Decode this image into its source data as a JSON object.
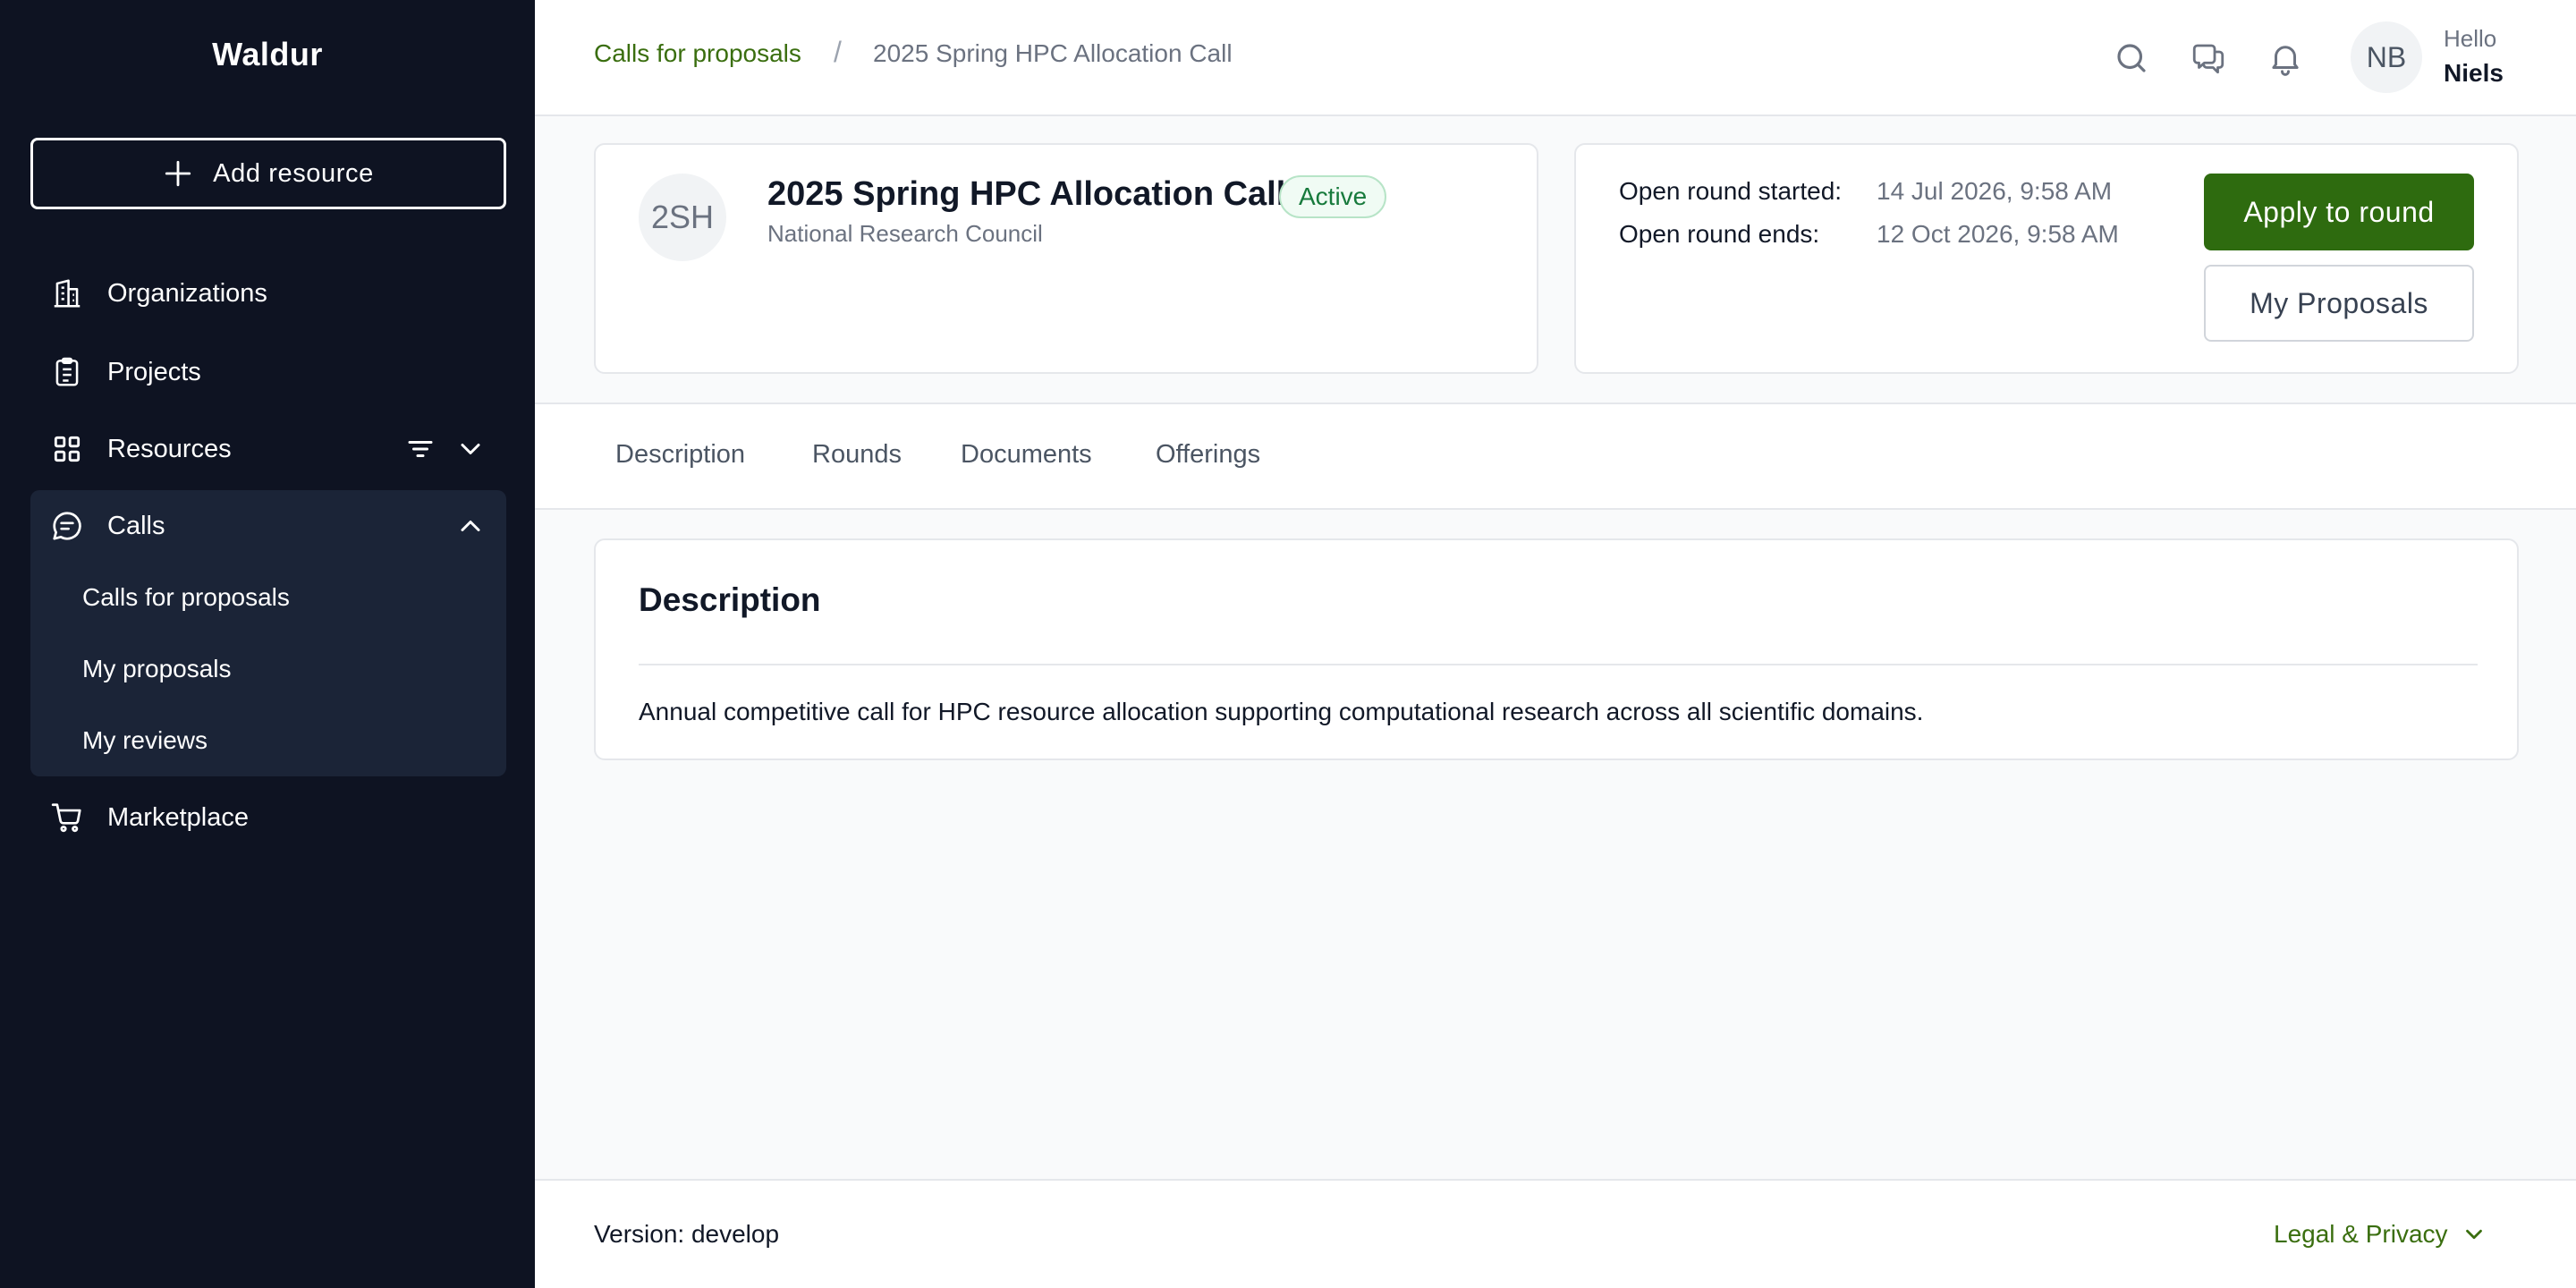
{
  "app": {
    "brand": "Waldur"
  },
  "sidebar": {
    "add_resource_label": "Add resource",
    "items": [
      {
        "label": "Organizations",
        "icon": "building-icon"
      },
      {
        "label": "Projects",
        "icon": "clipboard-icon"
      },
      {
        "label": "Resources",
        "icon": "grid-icon"
      },
      {
        "label": "Calls",
        "icon": "chat-bubble-icon"
      },
      {
        "label": "Marketplace",
        "icon": "cart-icon"
      }
    ],
    "calls_subitems": [
      {
        "label": "Calls for proposals"
      },
      {
        "label": "My proposals"
      },
      {
        "label": "My reviews"
      }
    ]
  },
  "header": {
    "breadcrumb_link": "Calls for proposals",
    "breadcrumb_separator": "/",
    "breadcrumb_current": "2025 Spring HPC Allocation Call",
    "icons": [
      "search-icon",
      "chat-icon",
      "bell-icon"
    ],
    "avatar_initials": "NB",
    "greeting": "Hello",
    "user_name": "Niels"
  },
  "call": {
    "initials": "2SH",
    "title": "2025 Spring HPC Allocation Call",
    "status": "Active",
    "organization": "National Research Council",
    "round_started_label": "Open round started:",
    "round_started_value": "14 Jul 2026, 9:58 AM",
    "round_ends_label": "Open round ends:",
    "round_ends_value": "12 Oct 2026, 9:58 AM",
    "apply_button": "Apply to round",
    "proposals_button": "My Proposals"
  },
  "tabs": [
    {
      "label": "Description"
    },
    {
      "label": "Rounds"
    },
    {
      "label": "Documents"
    },
    {
      "label": "Offerings"
    }
  ],
  "description": {
    "title": "Description",
    "text": "Annual competitive call for HPC resource allocation supporting computational research across all scientific domains."
  },
  "footer": {
    "version": "Version: develop",
    "legal": "Legal & Privacy"
  },
  "colors": {
    "sidebar_bg": "#0e1322",
    "accent_green": "#2e6b0f",
    "link_green": "#3a6e0f",
    "badge_green": "#177a3c"
  }
}
